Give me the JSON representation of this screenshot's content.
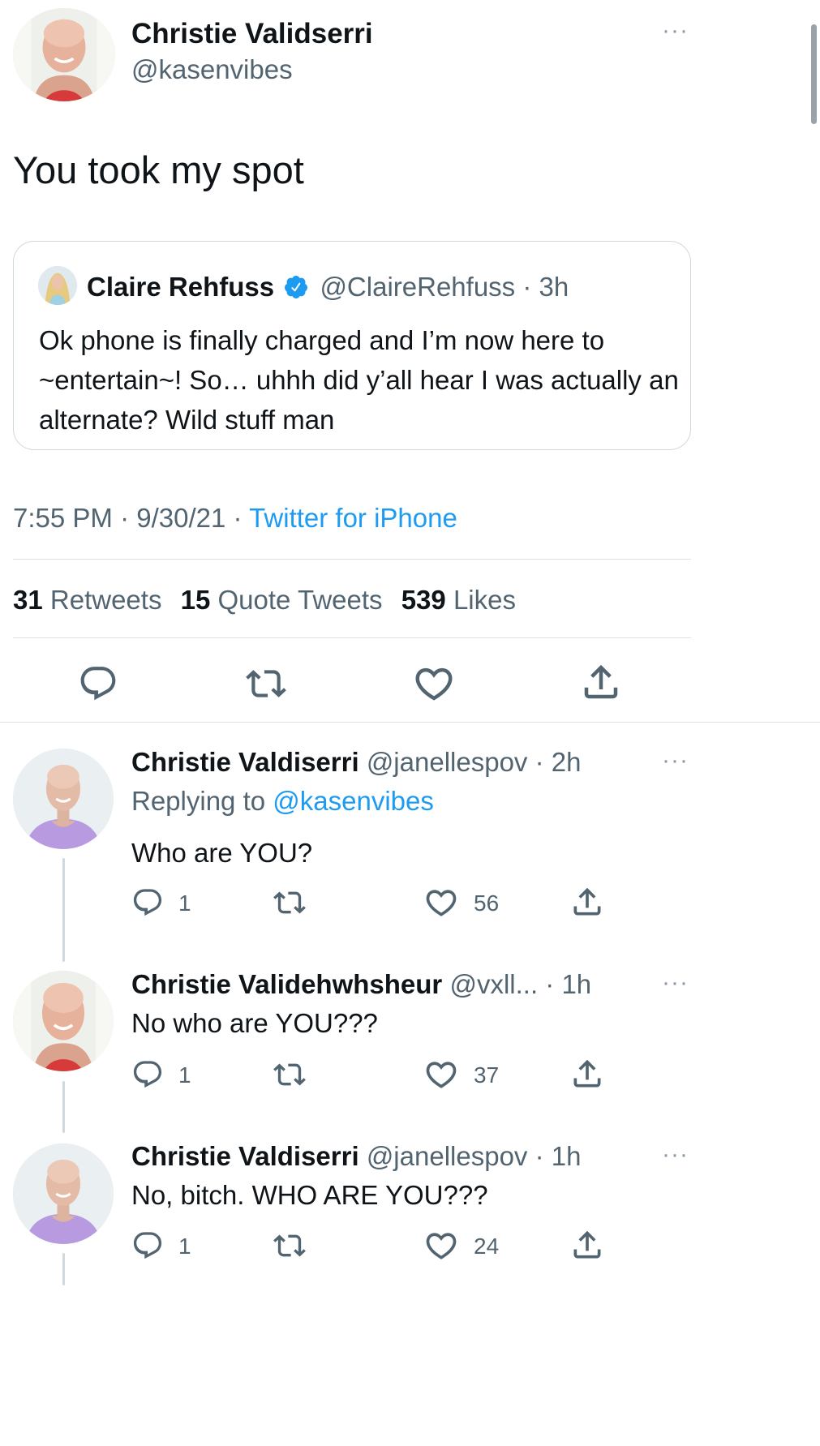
{
  "main_tweet": {
    "author_name": "Christie Validserri",
    "author_handle": "@kasenvibes",
    "text": "You took my spot",
    "quoted": {
      "author_name": "Claire Rehfuss",
      "verified": true,
      "handle_time": "@ClaireRehfuss · 3h",
      "text": "Ok phone is finally charged and I’m now here to ~entertain~! So… uhhh did y’all hear I was actually an alternate? Wild stuff man"
    },
    "timestamp": "7:55 PM · 9/30/21 · ",
    "source": "Twitter for iPhone",
    "stats": {
      "retweets_count": "31",
      "retweets_label": "Retweets",
      "quotes_count": "15",
      "quotes_label": "Quote Tweets",
      "likes_count": "539",
      "likes_label": "Likes"
    }
  },
  "replies": [
    {
      "author_name": "Christie Valdiserri",
      "handle_time": "@janellespov · 2h",
      "replying_prefix": "Replying to ",
      "replying_to": "@kasenvibes",
      "text": "Who are YOU?",
      "reply_count": "1",
      "like_count": "56",
      "avatar_style": "purple"
    },
    {
      "author_name": "Christie Validehwhsheur",
      "handle_time": "@vxll... · 1h",
      "text": "No who are YOU???",
      "reply_count": "1",
      "like_count": "37",
      "avatar_style": "white"
    },
    {
      "author_name": "Christie Valdiserri",
      "handle_time": "@janellespov · 1h",
      "text": "No, bitch. WHO ARE YOU???",
      "reply_count": "1",
      "like_count": "24",
      "avatar_style": "purple"
    }
  ],
  "colors": {
    "accent": "#1d9bf0",
    "text": "#0f1419",
    "muted": "#536471",
    "divider": "#dde3e8"
  },
  "icons": [
    "more-icon",
    "reply-icon",
    "retweet-icon",
    "like-icon",
    "share-icon",
    "verified-badge-icon"
  ]
}
